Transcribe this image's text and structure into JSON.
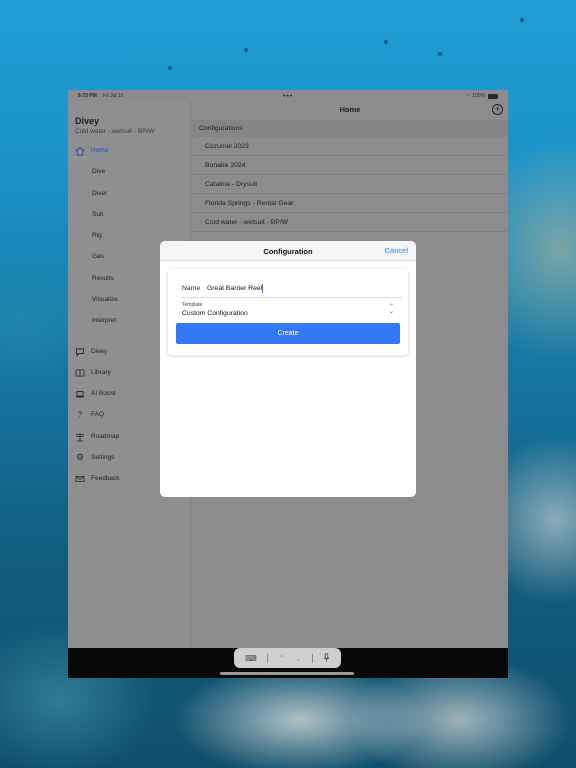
{
  "status_bar": {
    "time": "6:33 PM",
    "date": "Fri Jul 19",
    "battery": "100%"
  },
  "sidebar": {
    "title": "Divey",
    "subtitle": "Cold water - wetsuit - BP/W",
    "items": [
      {
        "label": "Home",
        "icon": "house-icon",
        "active": true
      },
      {
        "label": "Dive"
      },
      {
        "label": "Diver"
      },
      {
        "label": "Suit"
      },
      {
        "label": "Rig"
      },
      {
        "label": "Gas"
      },
      {
        "label": "Results"
      },
      {
        "label": "Visualize"
      },
      {
        "label": "Interpret"
      },
      {
        "label": "Divey",
        "icon": "chat-bubble-icon"
      },
      {
        "label": "Library",
        "icon": "book-icon"
      },
      {
        "label": "AI Boost",
        "icon": "laptop-icon"
      },
      {
        "label": "FAQ",
        "icon": "question-icon"
      },
      {
        "label": "Roadmap",
        "icon": "signpost-icon"
      },
      {
        "label": "Settings",
        "icon": "gear-icon"
      },
      {
        "label": "Feedback",
        "icon": "envelope-icon"
      }
    ]
  },
  "main": {
    "title": "Home",
    "section": "Configurations",
    "configurations": [
      "Cozumel 2023",
      "Bonaire 2024",
      "Catalina - Drysuit",
      "Florida Springs - Rental Gear",
      "Cold water - wetsuit - BP/W"
    ]
  },
  "modal": {
    "title": "Configuration",
    "cancel_label": "Cancel",
    "name_label": "Name",
    "name_value": "Great Barrier Reef",
    "template_label": "Template",
    "template_value": "Custom Configuration",
    "create_label": "Create"
  },
  "colors": {
    "accent": "#3478f6",
    "dim_overlay": "#8c8c8f"
  }
}
